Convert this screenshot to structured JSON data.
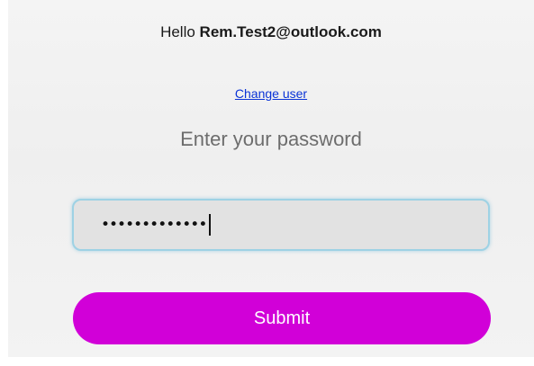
{
  "greeting": {
    "prefix": "Hello ",
    "email": "Rem.Test2@outlook.com"
  },
  "change_user": {
    "label": "Change user"
  },
  "password_prompt": {
    "label": "Enter your password"
  },
  "password_field": {
    "masked_value": "•••••••••••••"
  },
  "submit": {
    "label": "Submit"
  },
  "colors": {
    "accent": "#d100d8",
    "link": "#0a33d6",
    "field_border": "#9ed2e4"
  }
}
